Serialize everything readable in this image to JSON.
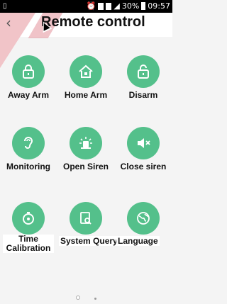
{
  "status_bar": {
    "left_icon": "phone-outline-icon",
    "battery": "30%",
    "time": "09:57"
  },
  "header": {
    "title": "Remote control",
    "back_icon": "chevron-left-icon"
  },
  "items": [
    {
      "label": "Away Arm",
      "icon": "lock-icon"
    },
    {
      "label": "Home Arm",
      "icon": "home-lock-icon"
    },
    {
      "label": "Disarm",
      "icon": "unlock-icon"
    },
    {
      "label": "Monitoring",
      "icon": "ear-icon"
    },
    {
      "label": "Open Siren",
      "icon": "siren-icon"
    },
    {
      "label": "Close siren",
      "icon": "mute-icon"
    },
    {
      "label": "Time Calibration",
      "icon": "stopwatch-icon"
    },
    {
      "label": "System Query",
      "icon": "query-icon"
    },
    {
      "label": "Language",
      "icon": "globe-icon"
    }
  ],
  "colors": {
    "accent": "#54c08b",
    "header_decor": "#f1c4c8"
  },
  "pager": {
    "pages": 2,
    "current": 1
  }
}
